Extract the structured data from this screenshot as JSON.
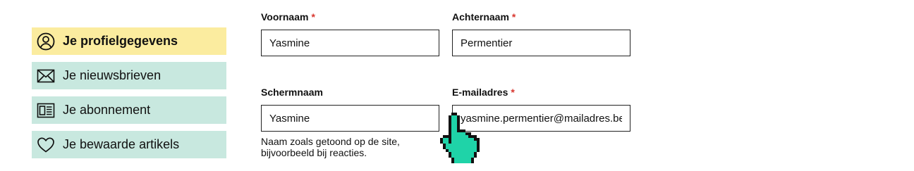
{
  "sidebar": {
    "items": [
      {
        "label": "Je profielgegevens",
        "icon": "user-circle-icon",
        "active": true
      },
      {
        "label": "Je nieuwsbrieven",
        "icon": "envelope-icon",
        "active": false
      },
      {
        "label": "Je abonnement",
        "icon": "newspaper-icon",
        "active": false
      },
      {
        "label": "Je bewaarde artikels",
        "icon": "heart-icon",
        "active": false
      }
    ]
  },
  "form": {
    "required_marker": "*",
    "first_name": {
      "label": "Voornaam",
      "value": "Yasmine"
    },
    "last_name": {
      "label": "Achternaam",
      "value": "Permentier"
    },
    "screen_name": {
      "label": "Schermnaam",
      "value": "Yasmine",
      "help": "Naam zoals getoond op de site, bijvoorbeeld bij reacties."
    },
    "email": {
      "label": "E-mailadres",
      "value": "yasmine.permentier@mailadres.be"
    }
  },
  "colors": {
    "active_nav": "#fbec9f",
    "nav": "#c8e8df",
    "required": "#d8372f",
    "cursor": "#1fd3a8"
  }
}
